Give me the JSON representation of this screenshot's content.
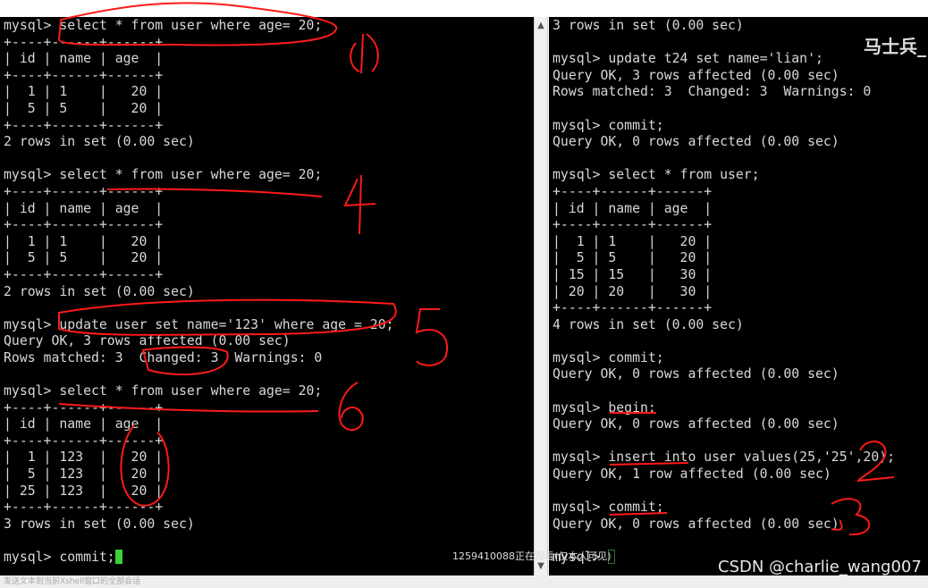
{
  "left_pane": {
    "lines": [
      "mysql> select * from user where age= 20;",
      "+----+------+------+",
      "| id | name | age  |",
      "+----+------+------+",
      "|  1 | 1    |   20 |",
      "|  5 | 5    |   20 |",
      "+----+------+------+",
      "2 rows in set (0.00 sec)",
      "",
      "mysql> select * from user where age= 20;",
      "+----+------+------+",
      "| id | name | age  |",
      "+----+------+------+",
      "|  1 | 1    |   20 |",
      "|  5 | 5    |   20 |",
      "+----+------+------+",
      "2 rows in set (0.00 sec)",
      "",
      "mysql> update user set name='123' where age = 20;",
      "Query OK, 3 rows affected (0.00 sec)",
      "Rows matched: 3  Changed: 3  Warnings: 0",
      "",
      "mysql> select * from user where age= 20;",
      "+----+------+------+",
      "| id | name | age  |",
      "+----+------+------+",
      "|  1 | 123  |   20 |",
      "|  5 | 123  |   20 |",
      "| 25 | 123  |   20 |",
      "+----+------+------+",
      "3 rows in set (0.00 sec)",
      "",
      "mysql> commit;"
    ]
  },
  "right_pane": {
    "lines": [
      "3 rows in set (0.00 sec)",
      "",
      "mysql> update t24 set name='lian';",
      "Query OK, 3 rows affected (0.00 sec)",
      "Rows matched: 3  Changed: 3  Warnings: 0",
      "",
      "mysql> commit;",
      "Query OK, 0 rows affected (0.00 sec)",
      "",
      "mysql> select * from user;",
      "+----+------+------+",
      "| id | name | age  |",
      "+----+------+------+",
      "|  1 | 1    |   20 |",
      "|  5 | 5    |   20 |",
      "| 15 | 15   |   30 |",
      "| 20 | 20   |   30 |",
      "+----+------+------+",
      "4 rows in set (0.00 sec)",
      "",
      "mysql> commit;",
      "Query OK, 0 rows affected (0.00 sec)",
      "",
      "mysql> begin;",
      "Query OK, 0 rows affected (0.00 sec)",
      "",
      "mysql> insert into user values(25,'25',20);",
      "Query OK, 1 row affected (0.00 sec)",
      "",
      "mysql> commit;",
      "Query OK, 0 rows affected (0.00 sec)",
      "",
      "mysql> "
    ]
  },
  "annotation_numbers": [
    "1",
    "4",
    "5",
    "6",
    "2",
    "3"
  ],
  "watermark_top": "马士兵_",
  "watermark_csdn": "CSDN @charlie_wang007",
  "viewer_notice": "1259410088正在观看(仅本人可见)",
  "status_bar": "发送文本到当前Xshell窗口的全部会话",
  "colors": {
    "terminal_bg": "#000000",
    "text": "#d8d8d8",
    "cursor": "#3bd13b",
    "annotation": "#ff1a1a"
  }
}
